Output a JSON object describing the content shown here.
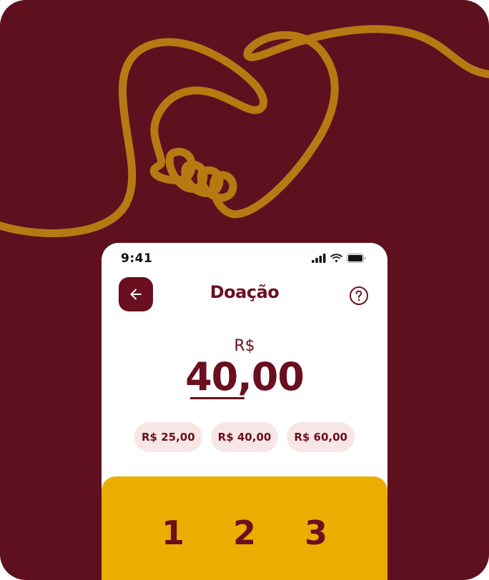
{
  "colors": {
    "background": "#5f101f",
    "brand": "#6a0f1f",
    "line_art": "#b77a12",
    "keypad": "#e9ae00",
    "chip": "#f8e6e6"
  },
  "status_bar": {
    "time": "9:41",
    "icons": [
      "signal-icon",
      "wifi-icon",
      "battery-icon"
    ]
  },
  "header": {
    "title": "Doação",
    "back_icon": "arrow-left-icon",
    "help_icon": "question-circle-icon"
  },
  "amount": {
    "currency": "R$",
    "value": "40,00"
  },
  "quick_amounts": [
    {
      "label": "R$ 25,00"
    },
    {
      "label": "R$ 40,00"
    },
    {
      "label": "R$ 60,00"
    }
  ],
  "keypad": {
    "keys": [
      "1",
      "2",
      "3"
    ]
  }
}
